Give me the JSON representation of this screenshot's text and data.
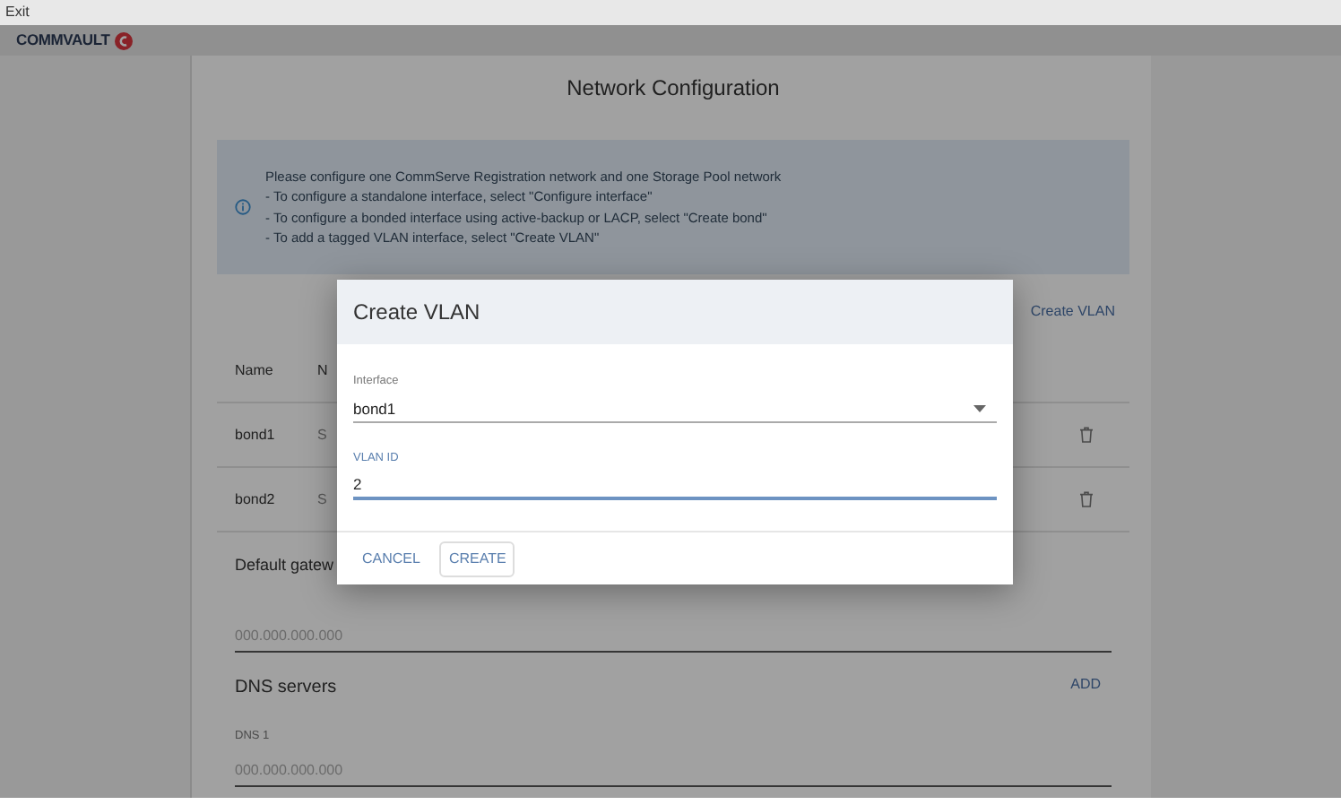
{
  "menu": {
    "exit": "Exit"
  },
  "header": {
    "logo": "COMMVAULT"
  },
  "page": {
    "title": "Network Configuration",
    "info": {
      "lines": [
        "Please configure one CommServe Registration network and one Storage Pool network",
        "- To configure a standalone interface, select \"Configure interface\"",
        "- To configure a bonded interface using active-backup or LACP, select \"Create bond\"",
        "- To add a tagged VLAN interface, select \"Create VLAN\""
      ]
    },
    "create_vlan": "Create VLAN",
    "table": {
      "columns": [
        "Name",
        "N"
      ],
      "rows": [
        {
          "name": "bond1",
          "column_2": "S"
        },
        {
          "name": "bond2",
          "column_2": "S"
        }
      ]
    },
    "default_gateway": {
      "label": "Default gatew",
      "placeholder": "000.000.000.000"
    },
    "dns": {
      "title": "DNS servers",
      "add": "ADD",
      "fields": [
        {
          "label": "DNS 1",
          "placeholder": "000.000.000.000"
        }
      ]
    }
  },
  "dialog": {
    "title": "Create VLAN",
    "fields": [
      {
        "kind": "select",
        "label": "Interface",
        "value": "bond1",
        "focused": false
      },
      {
        "kind": "text",
        "label": "VLAN ID",
        "value": "2",
        "focused": true
      }
    ],
    "buttons": [
      {
        "kind": "text",
        "label": "CANCEL"
      },
      {
        "kind": "outlined",
        "label": "CREATE"
      }
    ]
  }
}
